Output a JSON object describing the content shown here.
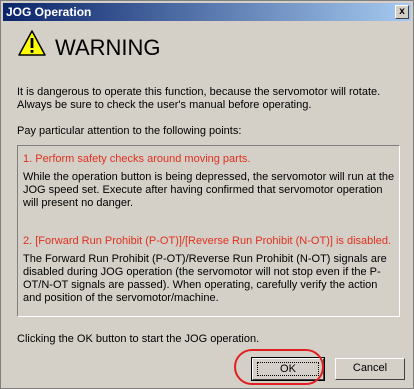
{
  "window": {
    "title": "JOG Operation",
    "close_glyph": "x"
  },
  "warning": {
    "icon": "warning-triangle-icon",
    "title": "WARNING"
  },
  "intro_text": "It is dangerous to operate this function, because the servomotor will rotate. Always be sure to check the user's manual before operating.",
  "pay_attention_text": "Pay particular attention to the following points:",
  "points": [
    {
      "heading": "1. Perform safety checks around moving parts.",
      "body": " While the operation button is being depressed, the servomotor will run at the JOG speed set. Execute after having confirmed that servomotor operation will present no danger."
    },
    {
      "heading": "2. [Forward Run Prohibit (P-OT)]/[Reverse Run Prohibit (N-OT)] is disabled.",
      "body": "The Forward Run Prohibit (P-OT)/Reverse Run Prohibit (N-OT) signals are disabled during JOG operation (the servomotor will not stop even if the P-OT/N-OT signals are passed). When operating, carefully verify the action and position of the  servomotor/machine."
    }
  ],
  "footer_text": "Clicking the OK button to start the JOG operation.",
  "buttons": {
    "ok": "OK",
    "cancel": "Cancel"
  },
  "colors": {
    "title_bar": "#0a246a",
    "warning_heading": "#e0301e",
    "highlight_ring": "#e02020",
    "dialog_face": "#d4d0c8"
  }
}
